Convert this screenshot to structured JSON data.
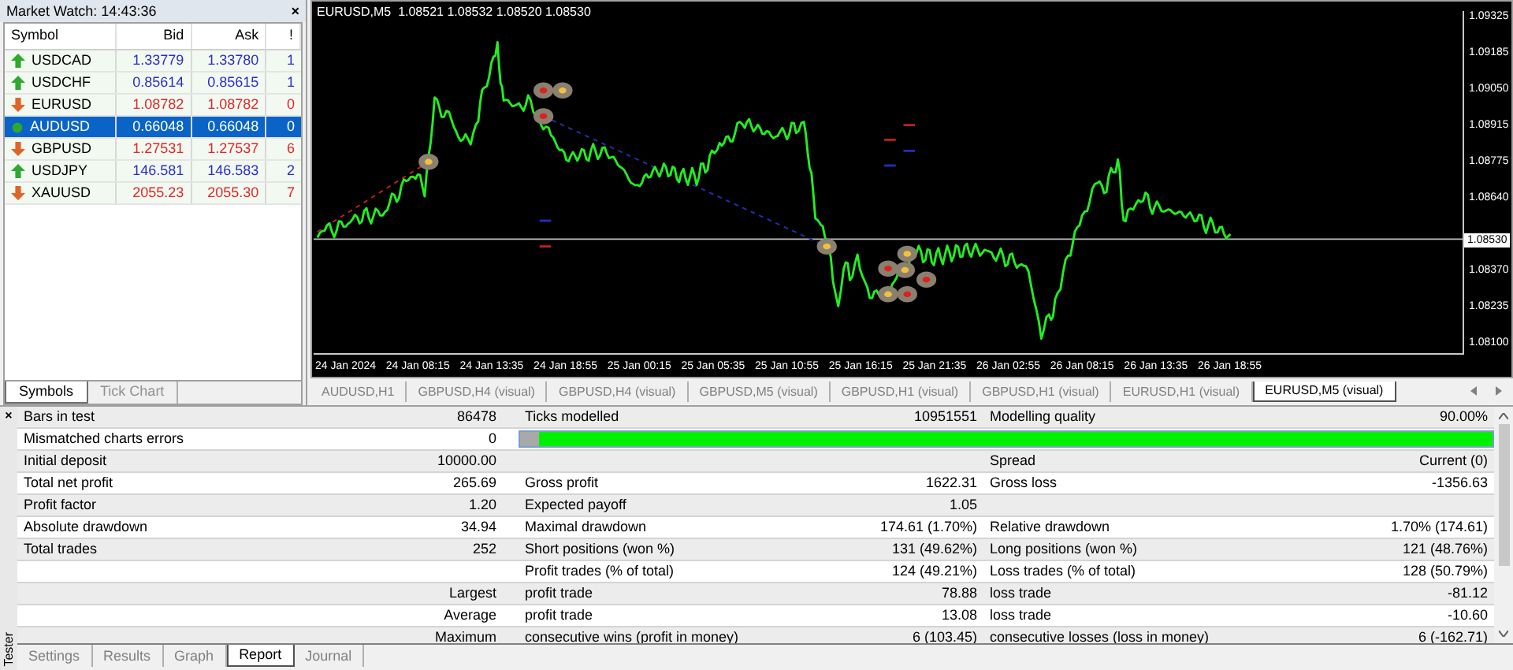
{
  "market_watch": {
    "title": "Market Watch: 14:43:36",
    "close": "×",
    "columns": [
      "Symbol",
      "Bid",
      "Ask",
      "!"
    ],
    "rows": [
      {
        "symbol": "USDCAD",
        "bid": "1.33779",
        "ask": "1.33780",
        "spread": "1",
        "kind": "up",
        "selected": false
      },
      {
        "symbol": "USDCHF",
        "bid": "0.85614",
        "ask": "0.85615",
        "spread": "1",
        "kind": "up",
        "selected": false
      },
      {
        "symbol": "EURUSD",
        "bid": "1.08782",
        "ask": "1.08782",
        "spread": "0",
        "kind": "down",
        "selected": false
      },
      {
        "symbol": "AUDUSD",
        "bid": "0.66048",
        "ask": "0.66048",
        "spread": "0",
        "kind": "flat",
        "selected": true
      },
      {
        "symbol": "GBPUSD",
        "bid": "1.27531",
        "ask": "1.27537",
        "spread": "6",
        "kind": "down",
        "selected": false
      },
      {
        "symbol": "USDJPY",
        "bid": "146.581",
        "ask": "146.583",
        "spread": "2",
        "kind": "up",
        "selected": false
      },
      {
        "symbol": "XAUUSD",
        "bid": "2055.23",
        "ask": "2055.30",
        "spread": "7",
        "kind": "down",
        "selected": false
      }
    ],
    "tabs": [
      {
        "label": "Symbols",
        "selected": true
      },
      {
        "label": "Tick Chart",
        "selected": false
      }
    ]
  },
  "chart": {
    "title": "EURUSD,M5  1.08521 1.08532 1.08520 1.08530",
    "price_labels": [
      "1.09325",
      "1.09185",
      "1.09050",
      "1.08915",
      "1.08775",
      "1.08640",
      "1.08370",
      "1.08235",
      "1.08100"
    ],
    "current_price": "1.08530",
    "time_labels": [
      "24 Jan 2024",
      "24 Jan 08:15",
      "24 Jan 13:35",
      "24 Jan 18:55",
      "25 Jan 00:15",
      "25 Jan 05:35",
      "25 Jan 10:55",
      "25 Jan 16:15",
      "25 Jan 21:35",
      "26 Jan 02:55",
      "26 Jan 08:15",
      "26 Jan 13:35",
      "26 Jan 18:55"
    ]
  },
  "chart_tabs": [
    {
      "label": "AUDUSD,H1",
      "selected": false
    },
    {
      "label": "GBPUSD,H4 (visual)",
      "selected": false
    },
    {
      "label": "GBPUSD,H4 (visual)",
      "selected": false
    },
    {
      "label": "GBPUSD,M5 (visual)",
      "selected": false
    },
    {
      "label": "GBPUSD,H1 (visual)",
      "selected": false
    },
    {
      "label": "GBPUSD,H1 (visual)",
      "selected": false
    },
    {
      "label": "EURUSD,H1 (visual)",
      "selected": false
    },
    {
      "label": "EURUSD,M5 (visual)",
      "selected": true
    }
  ],
  "tester": {
    "title": "Tester",
    "close": "×",
    "rows": [
      {
        "kind": "text",
        "column_1": "Bars in test",
        "column_2": "86478",
        "column_3": "Ticks modelled",
        "column_4": "10951551",
        "column_5": "Modelling quality",
        "column_6": "90.00%"
      },
      {
        "kind": "progress",
        "column_1": "Mismatched charts errors",
        "column_2": "0",
        "level": 0.98
      },
      {
        "kind": "text",
        "column_1": "Initial deposit",
        "column_2": "10000.00",
        "column_5": "Spread",
        "column_6": "Current (0)"
      },
      {
        "kind": "text",
        "column_1": "Total net profit",
        "column_2": "265.69",
        "column_3": "Gross profit",
        "column_4": "1622.31",
        "column_5": "Gross loss",
        "column_6": "-1356.63"
      },
      {
        "kind": "text",
        "column_1": "Profit factor",
        "column_2": "1.20",
        "column_3": "Expected payoff",
        "column_4": "1.05"
      },
      {
        "kind": "text",
        "column_1": "Absolute drawdown",
        "column_2": "34.94",
        "column_3": "Maximal drawdown",
        "column_4": "174.61 (1.70%)",
        "column_5": "Relative drawdown",
        "column_6": "1.70% (174.61)"
      },
      {
        "kind": "text",
        "column_1": "Total trades",
        "column_2": "252",
        "column_3": "Short positions (won %)",
        "column_4": "131 (49.62%)",
        "column_5": "Long positions (won %)",
        "column_6": "121 (48.76%)"
      },
      {
        "kind": "text",
        "column_3": "Profit trades (% of total)",
        "column_4": "124 (49.21%)",
        "column_5": "Loss trades (% of total)",
        "column_6": "128 (50.79%)"
      },
      {
        "kind": "text",
        "column_2": "Largest",
        "column_3": "profit trade",
        "column_4": "78.88",
        "column_5": "loss trade",
        "column_6": "-81.12"
      },
      {
        "kind": "text",
        "column_2": "Average",
        "column_3": "profit trade",
        "column_4": "13.08",
        "column_5": "loss trade",
        "column_6": "-10.60"
      },
      {
        "kind": "text",
        "column_2": "Maximum",
        "column_3": "consecutive wins (profit in money)",
        "column_4": "6 (103.45)",
        "column_5": "consecutive losses (loss in money)",
        "column_6": "6 (-162.71)"
      }
    ],
    "tabs": [
      {
        "label": "Settings",
        "selected": false
      },
      {
        "label": "Results",
        "selected": false
      },
      {
        "label": "Graph",
        "selected": false
      },
      {
        "label": "Report",
        "selected": true
      },
      {
        "label": "Journal",
        "selected": false
      }
    ]
  }
}
